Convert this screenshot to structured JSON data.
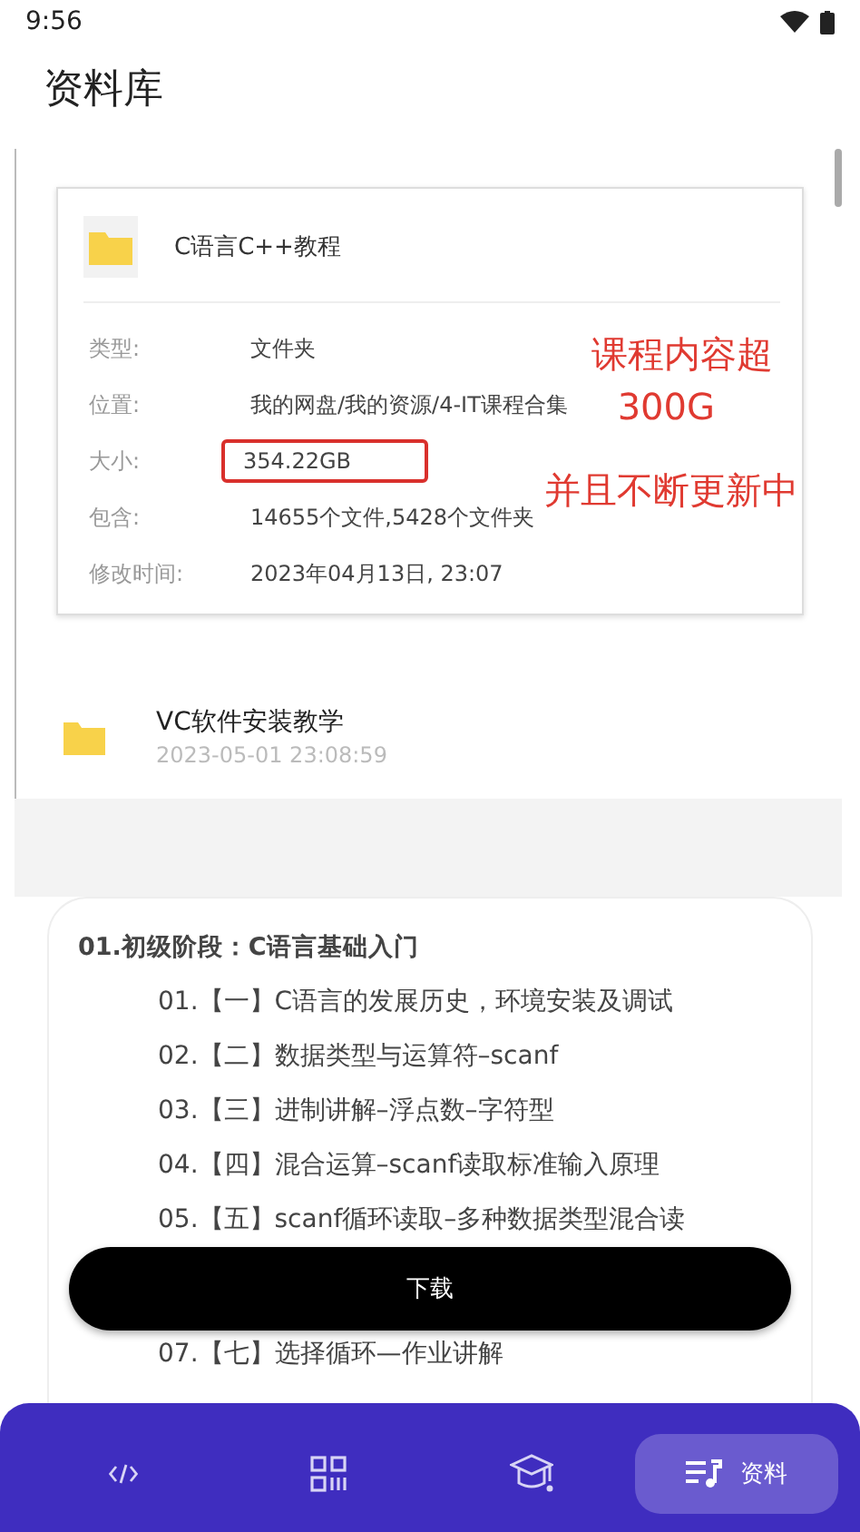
{
  "status_bar": {
    "time": "9:56"
  },
  "title": "资料库",
  "preview": {
    "file": {
      "name": "C语言C++教程",
      "rows": [
        {
          "label": "类型:",
          "value": "文件夹",
          "highlighted": false
        },
        {
          "label": "位置:",
          "value": "我的网盘/我的资源/4-IT课程合集",
          "highlighted": false
        },
        {
          "label": "大小:",
          "value": "354.22GB",
          "highlighted": true
        },
        {
          "label": "包含:",
          "value": "14655个文件,5428个文件夹",
          "highlighted": false
        },
        {
          "label": "修改时间:",
          "value": "2023年04月13日, 23:07",
          "highlighted": false
        }
      ]
    },
    "annotations": [
      "课程内容超",
      "300G",
      "并且不断更新中"
    ],
    "folder": {
      "name": "VC软件安装教学",
      "date": "2023-05-01  23:08:59"
    }
  },
  "outline": {
    "heading": "01.初级阶段：C语言基础入门",
    "items": [
      "01.【一】C语言的发展历史，环境安装及调试",
      "02.【二】数据类型与运算符–scanf",
      "03.【三】进制讲解–浮点数–字符型",
      "04.【四】混合运算–scanf读取标准输入原理",
      "05.【五】scanf循环读取–多种数据类型混合读"
    ],
    "after_button": [
      "07.【七】选择循环—作业讲解"
    ]
  },
  "download_button": "下载",
  "nav": [
    {
      "kind": "code",
      "selected": false
    },
    {
      "kind": "qr",
      "selected": false
    },
    {
      "kind": "school",
      "selected": false
    },
    {
      "kind": "library",
      "label": "资料",
      "selected": true
    }
  ]
}
